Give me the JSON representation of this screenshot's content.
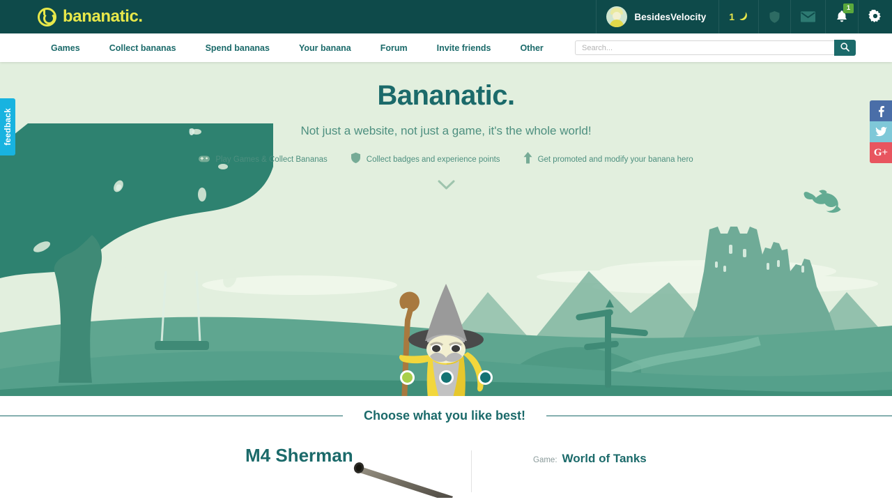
{
  "brand": {
    "name": "bananatic.",
    "logo_icon": "bananatic-logo-icon"
  },
  "topbar": {
    "username": "BesidesVelocity",
    "banana_count": "1",
    "banana_icon": "banana-icon",
    "avatar_icon": "user-avatar",
    "icons": [
      {
        "name": "shield-icon",
        "label": "Shield"
      },
      {
        "name": "envelope-icon",
        "label": "Messages"
      },
      {
        "name": "bell-icon",
        "label": "Notifications",
        "badge": "1"
      },
      {
        "name": "gear-icon",
        "label": "Settings"
      }
    ]
  },
  "nav": {
    "items": [
      {
        "label": "Games"
      },
      {
        "label": "Collect bananas"
      },
      {
        "label": "Spend bananas"
      },
      {
        "label": "Your banana"
      },
      {
        "label": "Forum"
      },
      {
        "label": "Invite friends"
      },
      {
        "label": "Other"
      }
    ]
  },
  "search": {
    "placeholder": "Search...",
    "value": "",
    "icon": "search-icon"
  },
  "hero": {
    "title": "Bananatic.",
    "subtitle": "Not just a website, not just a game, it's the whole world!",
    "features": [
      {
        "icon": "gamepad-icon",
        "label": "Play Games & Collect Bananas"
      },
      {
        "icon": "shield-icon",
        "label": "Collect badges and experience points"
      },
      {
        "icon": "arrow-up-icon",
        "label": "Get promoted and modify your banana hero"
      }
    ],
    "scroll_icon": "chevron-down-icon",
    "carousel": {
      "total": 3,
      "active_index": 0
    },
    "character": "banana-wizard",
    "scenery": [
      "tree-with-swing",
      "mountains",
      "castle",
      "signpost",
      "dragon",
      "winding-path"
    ]
  },
  "feedback": {
    "label": "feedback"
  },
  "social": [
    {
      "name": "facebook-icon",
      "glyph": "f",
      "color": "#4a6ea8"
    },
    {
      "name": "twitter-icon",
      "glyph": "✓",
      "color": "#7fc8d8"
    },
    {
      "name": "google-plus-icon",
      "glyph": "G+",
      "color": "#e8555f"
    }
  ],
  "choose_section": {
    "title": "Choose what you like best!"
  },
  "game_card": {
    "title": "M4 Sherman",
    "game_label": "Game:",
    "game_name": "World of Tanks",
    "image": "tank-barrel-image"
  },
  "colors": {
    "header_bg": "#0e4a4a",
    "brand_yellow": "#e8e84a",
    "teal": "#1b6a6a",
    "hero_sky": "#e2efde",
    "hero_green": "#57a18d",
    "accent_green": "#a8cf4a",
    "feedback_blue": "#18b3e0"
  }
}
